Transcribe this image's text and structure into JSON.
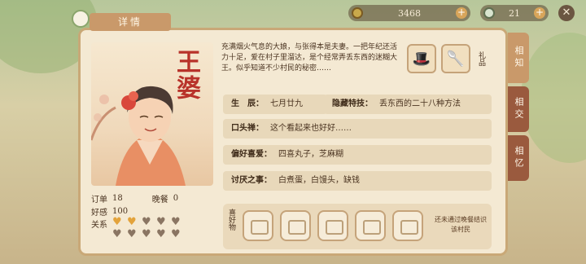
{
  "header": {
    "title": "详情"
  },
  "currencies": [
    {
      "icon": "coin-icon",
      "value": "3468"
    },
    {
      "icon": "jade-icon",
      "value": "21"
    }
  ],
  "character": {
    "name": "王婆",
    "description": "充满烟火气息的大娘，与张得本是夫妻。一把年纪还活力十足，爱在村子里溜达，是个经常弄丢东西的迷糊大王。似乎知道不少村民的秘密……",
    "stats": {
      "orders_label": "订单",
      "orders_value": "18",
      "dinner_label": "晚餐",
      "dinner_value": "0",
      "favor_label": "好感",
      "favor_value": "100",
      "relation_label": "关系",
      "relation_filled": 2,
      "relation_total": 10
    },
    "info": {
      "birthday_label": "生　辰：",
      "birthday_value": "七月廿九",
      "skill_label": "隐藏特技：",
      "skill_value": "丢东西的二十八种方法",
      "catchphrase_label": "口头禅：",
      "catchphrase_value": "这个看起来也好好……",
      "likes_label": "偏好喜爱：",
      "likes_value": "四喜丸子，芝麻糊",
      "dislikes_label": "讨厌之事：",
      "dislikes_value": "白煮蛋，白馒头，缺钱"
    }
  },
  "gifts": {
    "label": "礼品"
  },
  "preferences": {
    "label": "喜好物",
    "hint": "还未通过晚餐结识该村民"
  },
  "side_tabs": [
    {
      "label": "相知",
      "active": true
    },
    {
      "label": "相交",
      "active": false
    },
    {
      "label": "相忆",
      "active": false
    }
  ],
  "colors": {
    "accent": "#c9996a",
    "name_red": "#b8322a",
    "heart_gold": "#e3a33b",
    "heart_empty": "#8a7562"
  }
}
